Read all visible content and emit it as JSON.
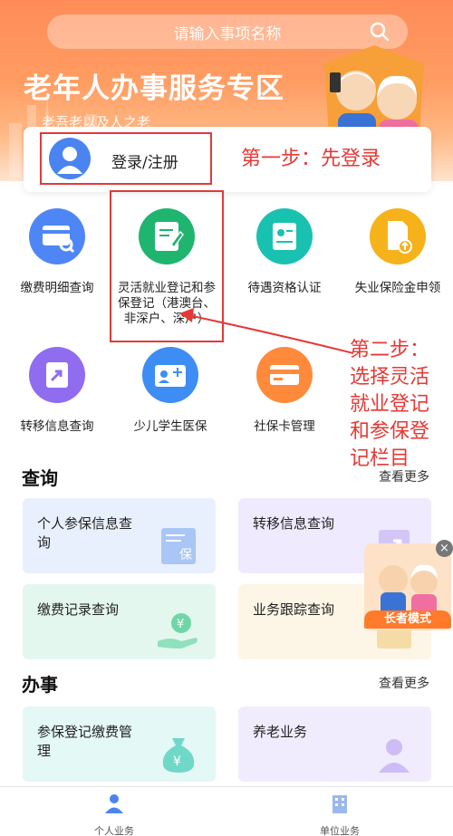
{
  "search": {
    "placeholder": "请输入事项名称"
  },
  "banner": {
    "title": "老年人办事服务专区",
    "subtitle": "老吾老以及人之老"
  },
  "login": {
    "label": "登录/注册"
  },
  "annotations": {
    "step1": "第一步：先登录",
    "step2_lines": [
      "第二步：",
      "选择灵活",
      "就业登记",
      "和参保登",
      "记栏目"
    ]
  },
  "services": [
    {
      "label": "缴费明细查询",
      "icon": "card-search-icon",
      "color": "#4f86f5"
    },
    {
      "label": "灵活就业登记和参保登记（港澳台、非深户、深户）",
      "icon": "edit-document-icon",
      "color": "#1fb56f"
    },
    {
      "label": "待遇资格认证",
      "icon": "id-verify-icon",
      "color": "#19c2b0"
    },
    {
      "label": "失业保险金申领",
      "icon": "document-upload-icon",
      "color": "#f5b21b"
    },
    {
      "label": "转移信息查询",
      "icon": "transfer-icon",
      "color": "#8f6cf0"
    },
    {
      "label": "少儿学生医保",
      "icon": "student-card-icon",
      "color": "#3d8df5"
    },
    {
      "label": "社保卡管理",
      "icon": "card-icon",
      "color": "#ff8a3c"
    }
  ],
  "query_section": {
    "title": "查询",
    "see_more": "查看更多",
    "cards": [
      {
        "label": "个人参保信息查询",
        "art_text": "保"
      },
      {
        "label": "转移信息查询"
      },
      {
        "label": "缴费记录查询",
        "art_text": "¥"
      },
      {
        "label": "业务跟踪查询"
      }
    ]
  },
  "work_section": {
    "title": "办事",
    "see_more": "查看更多",
    "cards": [
      {
        "label": "参保登记缴费管理",
        "art_text": "¥"
      },
      {
        "label": "养老业务"
      }
    ]
  },
  "elder_mode": {
    "label": "长者模式",
    "close": "×"
  },
  "bottom_nav": {
    "personal": "个人业务",
    "company": "单位业务"
  }
}
